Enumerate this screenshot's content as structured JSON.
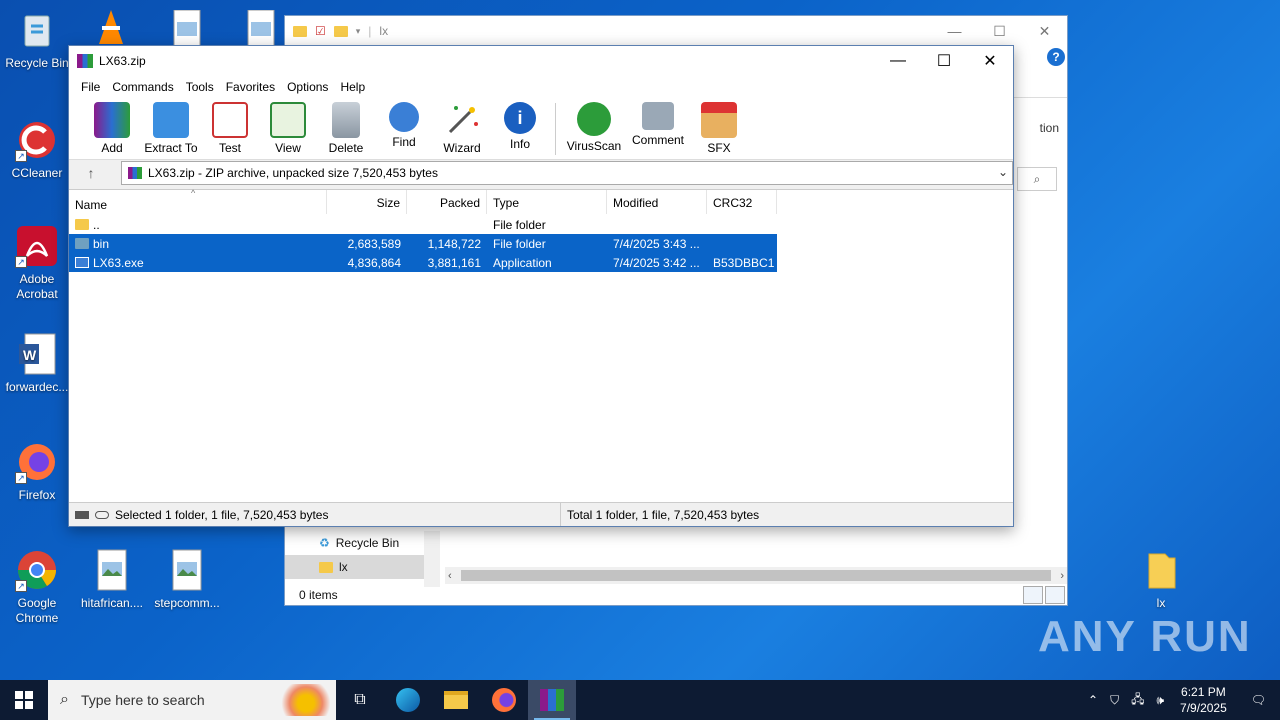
{
  "desktop": {
    "icons": [
      {
        "label": "Recycle Bin",
        "icon": "recycle-bin-icon"
      },
      {
        "label": "CCleaner",
        "icon": "ccleaner-icon"
      },
      {
        "label": "Adobe Acrobat",
        "icon": "acrobat-icon"
      },
      {
        "label": "forwardec...",
        "icon": "word-doc-icon"
      },
      {
        "label": "Firefox",
        "icon": "firefox-icon"
      },
      {
        "label": "Google Chrome",
        "icon": "chrome-icon"
      },
      {
        "label": "hitafrican....",
        "icon": "image-file-icon"
      },
      {
        "label": "stepcomm...",
        "icon": "image-file-icon"
      },
      {
        "label": "lx",
        "icon": "folder-icon"
      }
    ]
  },
  "explorer": {
    "title": "lx",
    "partial_text": "tion",
    "nav_items": [
      "Recycle Bin",
      "lx"
    ],
    "status": "0 items"
  },
  "rar": {
    "title": "LX63.zip",
    "menu": [
      "File",
      "Commands",
      "Tools",
      "Favorites",
      "Options",
      "Help"
    ],
    "toolbar": [
      "Add",
      "Extract To",
      "Test",
      "View",
      "Delete",
      "Find",
      "Wizard",
      "Info",
      "VirusScan",
      "Comment",
      "SFX"
    ],
    "address": "LX63.zip - ZIP archive, unpacked size 7,520,453 bytes",
    "columns": [
      "Name",
      "Size",
      "Packed",
      "Type",
      "Modified",
      "CRC32"
    ],
    "rows": [
      {
        "name": "..",
        "size": "",
        "packed": "",
        "type": "File folder",
        "modified": "",
        "crc": "",
        "selected": false
      },
      {
        "name": "bin",
        "size": "2,683,589",
        "packed": "1,148,722",
        "type": "File folder",
        "modified": "7/4/2025 3:43 ...",
        "crc": "",
        "selected": true
      },
      {
        "name": "LX63.exe",
        "size": "4,836,864",
        "packed": "3,881,161",
        "type": "Application",
        "modified": "7/4/2025 3:42 ...",
        "crc": "B53DBBC1",
        "selected": true
      }
    ],
    "status_left": "Selected 1 folder, 1 file, 7,520,453 bytes",
    "status_right": "Total 1 folder, 1 file, 7,520,453 bytes"
  },
  "taskbar": {
    "search_placeholder": "Type here to search",
    "time": "6:21 PM",
    "date": "7/9/2025"
  },
  "watermark": "ANY RUN"
}
